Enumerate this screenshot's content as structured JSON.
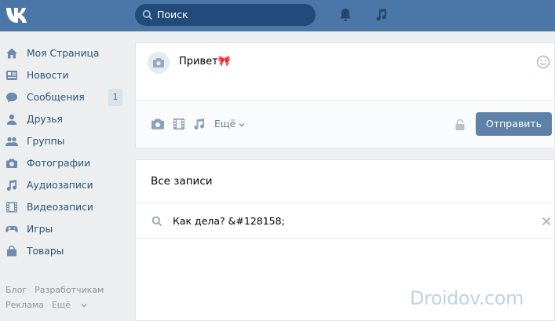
{
  "header": {
    "logo": "VK",
    "search_placeholder": "Поиск",
    "icons": [
      "bell-icon",
      "music-icon"
    ],
    "colors": {
      "bar": "#4a76a8",
      "search_bg": "#224b7a"
    }
  },
  "sidebar": {
    "items": [
      {
        "label": "Моя Страница",
        "icon": "home-icon"
      },
      {
        "label": "Новости",
        "icon": "news-icon"
      },
      {
        "label": "Сообщения",
        "icon": "messages-icon",
        "count": "1"
      },
      {
        "label": "Друзья",
        "icon": "friend-icon"
      },
      {
        "label": "Группы",
        "icon": "groups-icon"
      },
      {
        "label": "Фотографии",
        "icon": "camera-icon"
      },
      {
        "label": "Аудиозаписи",
        "icon": "music-icon"
      },
      {
        "label": "Видеозаписи",
        "icon": "film-icon"
      },
      {
        "label": "Игры",
        "icon": "gamepad-icon"
      },
      {
        "label": "Товары",
        "icon": "bag-icon"
      }
    ],
    "footer": {
      "blog": "Блог",
      "developers": "Разработчикам",
      "ads": "Реклама",
      "more": "Ещё"
    }
  },
  "composer": {
    "text": "Привет🎀",
    "more_label": "Ещё",
    "send_label": "Отправить",
    "colors": {
      "send": "#5e81a8"
    }
  },
  "records": {
    "title": "Все записи",
    "query": "Как дела? &#128158;"
  },
  "watermark": "Droidov.com"
}
